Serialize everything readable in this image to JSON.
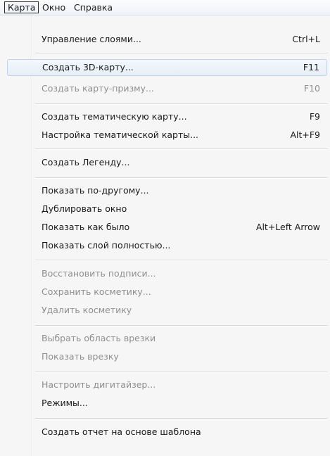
{
  "menubar": {
    "items": [
      "Карта",
      "Окно",
      "Справка"
    ]
  },
  "menu": {
    "items": [
      {
        "label": "Управление слоями...",
        "shortcut": "Ctrl+L"
      },
      {
        "label": "Создать 3D-карту...",
        "shortcut": "F11"
      },
      {
        "label": "Создать карту-призму...",
        "shortcut": "F10"
      },
      {
        "label": "Создать тематическую карту...",
        "shortcut": "F9"
      },
      {
        "label": "Настройка тематической карты...",
        "shortcut": "Alt+F9"
      },
      {
        "label": "Создать Легенду...",
        "shortcut": ""
      },
      {
        "label": "Показать по-другому...",
        "shortcut": ""
      },
      {
        "label": "Дублировать окно",
        "shortcut": ""
      },
      {
        "label": "Показать как было",
        "shortcut": "Alt+Left Arrow"
      },
      {
        "label": "Показать слой полностью...",
        "shortcut": ""
      },
      {
        "label": "Восстановить подписи...",
        "shortcut": ""
      },
      {
        "label": "Сохранить косметику...",
        "shortcut": ""
      },
      {
        "label": "Удалить косметику",
        "shortcut": ""
      },
      {
        "label": "Выбрать область врезки",
        "shortcut": ""
      },
      {
        "label": "Показать врезку",
        "shortcut": ""
      },
      {
        "label": "Настроить дигитайзер...",
        "shortcut": ""
      },
      {
        "label": "Режимы...",
        "shortcut": ""
      },
      {
        "label": "Создать отчет на основе шаблона",
        "shortcut": ""
      }
    ]
  }
}
